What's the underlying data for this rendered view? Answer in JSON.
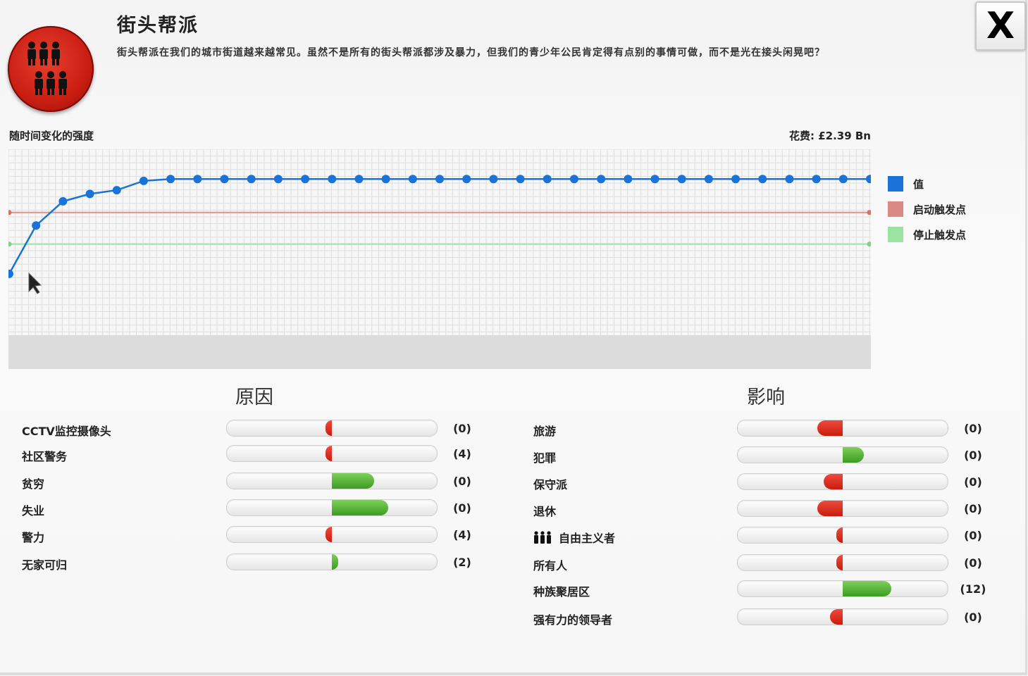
{
  "header": {
    "title": "街头帮派",
    "description": "街头帮派在我们的城市街道越来越常见。虽然不是所有的街头帮派都涉及暴力，但我们的青少年公民肯定得有点别的事情可做，而不是光在接头闲晃吧？",
    "close_label": "X"
  },
  "chart": {
    "label": "随时间变化的强度",
    "cost": "花费: £2.39 Bn"
  },
  "legend": [
    {
      "label": "值",
      "color": "#1a73d8"
    },
    {
      "label": "启动触发点",
      "color": "#d98a84"
    },
    {
      "label": "停止触发点",
      "color": "#9be3a0"
    }
  ],
  "chart_data": {
    "type": "line",
    "ylim": [
      0,
      1
    ],
    "grid": true,
    "legend_position": "right",
    "series": [
      {
        "name": "值",
        "values": [
          0.33,
          0.59,
          0.72,
          0.76,
          0.78,
          0.83,
          0.84,
          0.84,
          0.84,
          0.84,
          0.84,
          0.84,
          0.84,
          0.84,
          0.84,
          0.84,
          0.84,
          0.84,
          0.84,
          0.84,
          0.84,
          0.84,
          0.84,
          0.84,
          0.84,
          0.84,
          0.84,
          0.84,
          0.84,
          0.84,
          0.84,
          0.84,
          0.84
        ]
      },
      {
        "name": "启动触发点",
        "values": [
          0.66,
          0.66
        ]
      },
      {
        "name": "停止触发点",
        "values": [
          0.49,
          0.49
        ]
      }
    ]
  },
  "causes": {
    "title": "原因",
    "items": [
      {
        "label": "CCTV监控摄像头",
        "count": "(0)",
        "effect": -0.03
      },
      {
        "label": "社区警务",
        "count": "(4)",
        "effect": -0.03
      },
      {
        "label": "贫穷",
        "count": "(0)",
        "effect": 0.2
      },
      {
        "label": "失业",
        "count": "(0)",
        "effect": 0.27
      },
      {
        "label": "警力",
        "count": "(4)",
        "effect": -0.03
      },
      {
        "label": "无家可归",
        "count": "(2)",
        "effect": 0.03
      }
    ]
  },
  "effects": {
    "title": "影响",
    "items": [
      {
        "label": "旅游",
        "count": "(0)",
        "effect": -0.12
      },
      {
        "label": "犯罪",
        "count": "(0)",
        "effect": 0.1
      },
      {
        "label": "保守派",
        "count": "(0)",
        "effect": -0.09
      },
      {
        "label": "退休",
        "count": "(0)",
        "effect": -0.12
      },
      {
        "label": "自由主义者",
        "count": "(0)",
        "effect": -0.03,
        "icon": "people-icon"
      },
      {
        "label": "所有人",
        "count": "(0)",
        "effect": -0.03
      },
      {
        "label": "种族聚居区",
        "count": "(12)",
        "effect": 0.23
      },
      {
        "label": "强有力的领导者",
        "count": "(0)",
        "effect": -0.06
      }
    ]
  }
}
